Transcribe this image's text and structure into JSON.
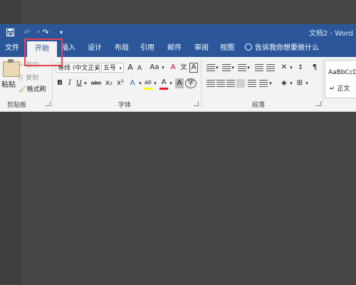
{
  "titlebar": {
    "doc_title": "文档2 - Word",
    "icons": [
      "save-icon",
      "undo-icon",
      "redo-icon",
      "customize-qat-icon"
    ]
  },
  "tabs": [
    {
      "label": "文件",
      "active": false
    },
    {
      "label": "开始",
      "active": true
    },
    {
      "label": "插入",
      "active": false
    },
    {
      "label": "设计",
      "active": false
    },
    {
      "label": "布局",
      "active": false
    },
    {
      "label": "引用",
      "active": false
    },
    {
      "label": "邮件",
      "active": false
    },
    {
      "label": "审阅",
      "active": false
    },
    {
      "label": "视图",
      "active": false
    }
  ],
  "tell_me": "告诉我你想要做什么",
  "clipboard": {
    "paste": "粘贴",
    "cut": "剪切",
    "copy": "复制",
    "format_painter": "格式刷",
    "group_label": "剪贴板"
  },
  "font": {
    "font_name": "等线 (中文正文)",
    "font_size": "五号",
    "grow": "A",
    "shrink": "A",
    "change_case": "Aa",
    "clear_format": "A",
    "phonetic": "文",
    "border_char": "A",
    "bold": "B",
    "italic": "I",
    "underline": "U",
    "strikethrough": "abc",
    "subscript": "x₂",
    "superscript": "x²",
    "text_effect": "A",
    "highlight": "ab",
    "font_color": "A",
    "char_shading": "A",
    "enclose": "字",
    "group_label": "字体"
  },
  "paragraph": {
    "group_label": "段落"
  },
  "styles": {
    "sample": "AaBbCcD",
    "name": "↵ 正文"
  },
  "colors": {
    "brand": "#2b579a",
    "highlight_frame": "#e8404f",
    "font_color_bar": "#e81b23",
    "highlight_bar": "#ffff00"
  }
}
